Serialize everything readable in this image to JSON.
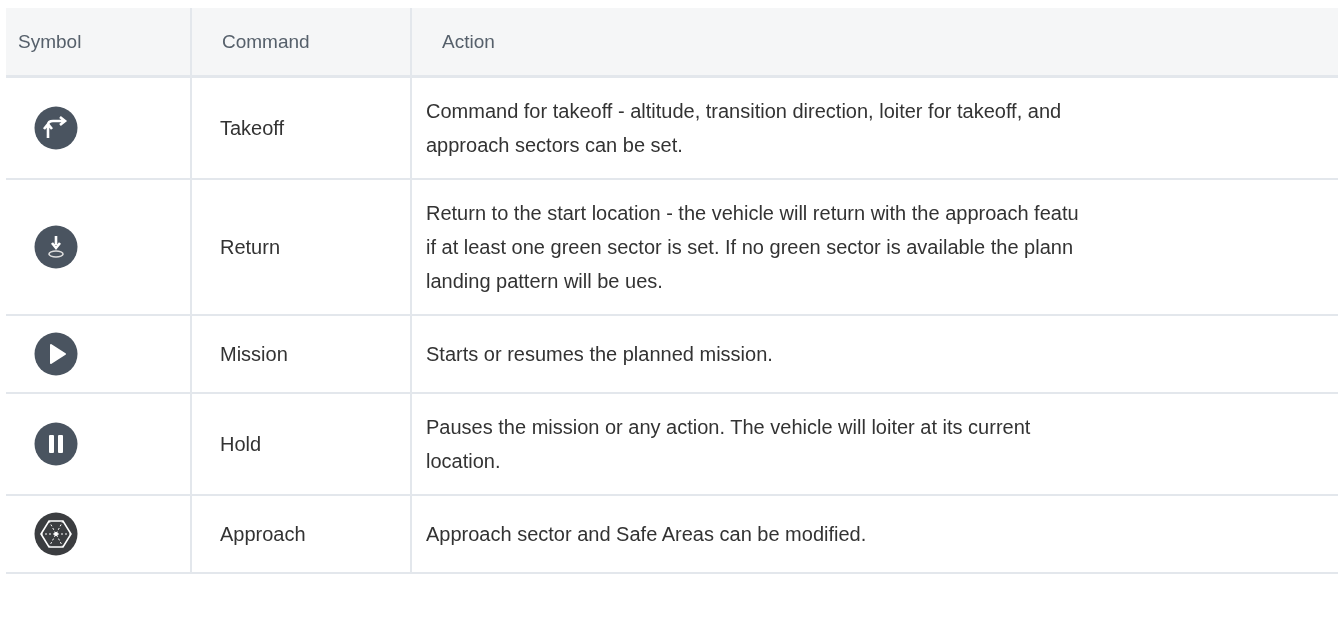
{
  "table": {
    "columns": [
      "Symbol",
      "Command",
      "Action"
    ],
    "rows": [
      {
        "kind": "takeoff",
        "command": "Takeoff",
        "action": [
          "Command for takeoff - altitude, transition direction, loiter for takeoff, and",
          "approach sectors can be set."
        ]
      },
      {
        "kind": "return",
        "command": "Return",
        "action": [
          "Return to the start location - the vehicle will return with the approach featu",
          "if at least one green sector is set. If no green sector is available the plann",
          "landing pattern will be ues."
        ]
      },
      {
        "kind": "mission",
        "command": "Mission",
        "action": [
          "Starts or resumes the planned mission."
        ]
      },
      {
        "kind": "hold",
        "command": "Hold",
        "action": [
          "Pauses the mission or any action. The vehicle will loiter at its current",
          "location."
        ]
      },
      {
        "kind": "approach",
        "command": "Approach",
        "action": [
          "Approach sector and Safe Areas can be modified."
        ]
      }
    ]
  }
}
